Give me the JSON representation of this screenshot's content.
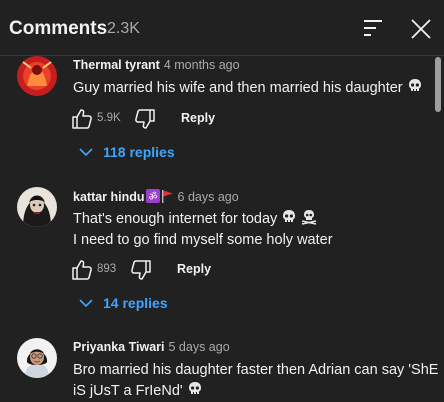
{
  "header": {
    "title": "Comments",
    "count": "2.3K"
  },
  "comments": [
    {
      "author": "Thermal tyrant",
      "time": "4 months ago",
      "lines": [
        "Guy married his wife and then married his daughter"
      ],
      "likes": "5.9K",
      "reply_label": "Reply",
      "replies_label": "118 replies"
    },
    {
      "author": "kattar hindu",
      "time": "6 days ago",
      "lines": [
        "That's enough internet for today",
        "I need to go find myself some holy water"
      ],
      "likes": "893",
      "reply_label": "Reply",
      "replies_label": "14 replies"
    },
    {
      "author": "Priyanka Tiwari",
      "time": "5 days ago",
      "lines": [
        "Bro married his daughter faster then Adrian can say 'ShE",
        "iS jUsT a FrIeNd'"
      ]
    }
  ],
  "icons": {
    "sort": "sort-icon",
    "close": "close-icon",
    "like": "thumbs-up-icon",
    "dislike": "thumbs-down-icon",
    "expand": "chevron-down-icon",
    "skull": "skull-emoji-icon",
    "crossbones": "skull-crossbones-emoji-icon",
    "om": "om-emoji-icon",
    "flag": "flag-emoji-icon"
  },
  "colors": {
    "background": "#212121",
    "text": "#f1f1f1",
    "secondary": "#aaaaaa",
    "link": "#3ea6ff"
  }
}
